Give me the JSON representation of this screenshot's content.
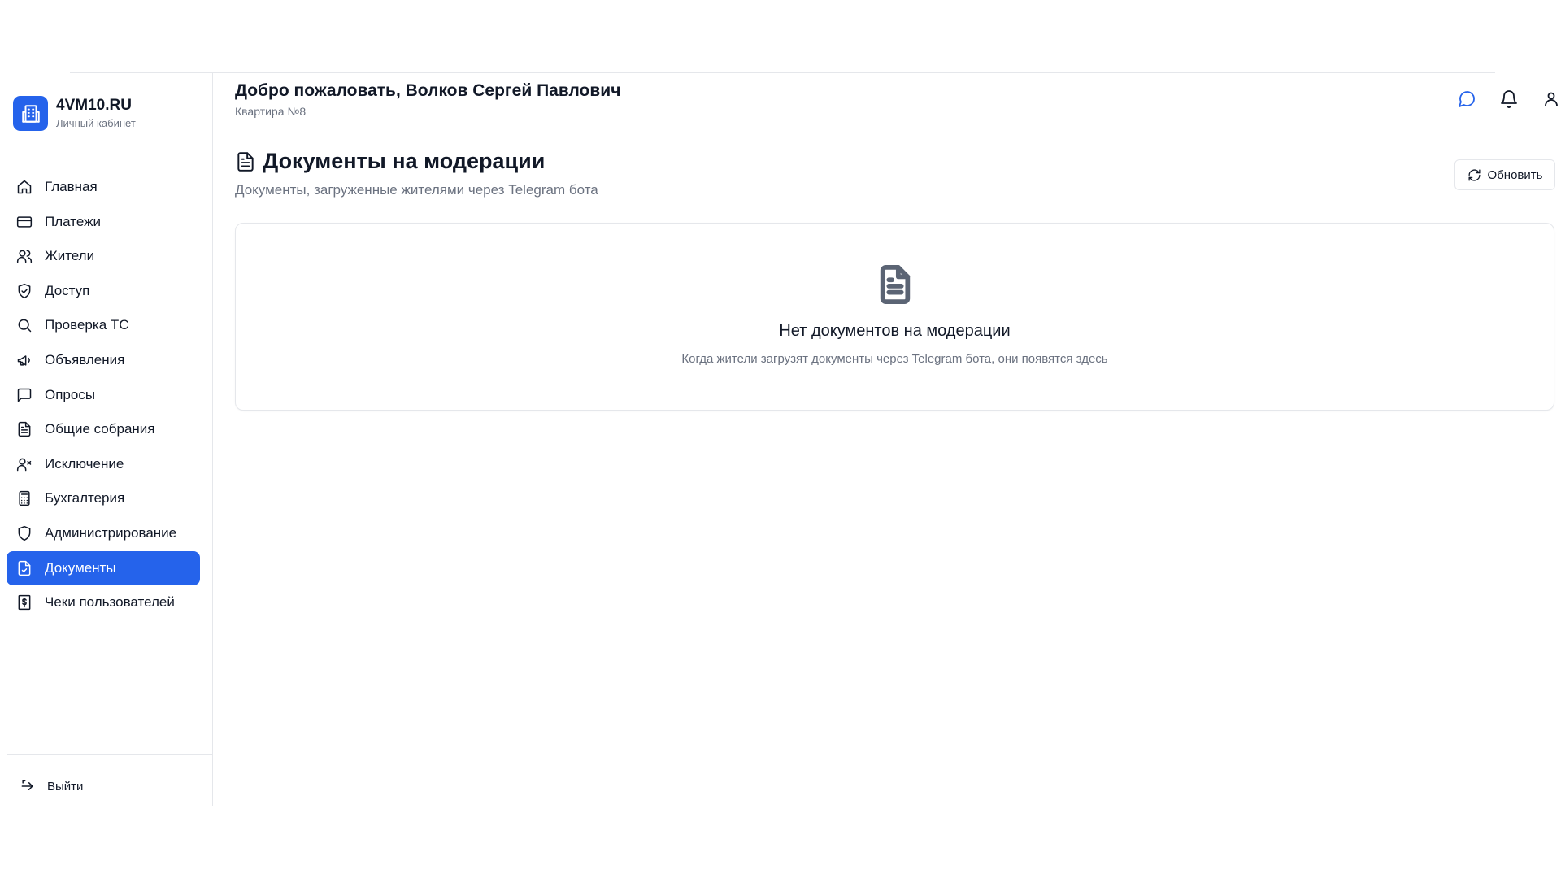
{
  "brand": {
    "title": "4VM10.RU",
    "subtitle": "Личный кабинет"
  },
  "sidebar": {
    "items": [
      {
        "label": "Главная",
        "icon": "home-icon"
      },
      {
        "label": "Платежи",
        "icon": "credit-card-icon"
      },
      {
        "label": "Жители",
        "icon": "users-icon"
      },
      {
        "label": "Доступ",
        "icon": "shield-check-icon"
      },
      {
        "label": "Проверка ТС",
        "icon": "search-icon"
      },
      {
        "label": "Объявления",
        "icon": "megaphone-icon"
      },
      {
        "label": "Опросы",
        "icon": "message-square-icon"
      },
      {
        "label": "Общие собрания",
        "icon": "file-text-icon"
      },
      {
        "label": "Исключение",
        "icon": "user-x-icon"
      },
      {
        "label": "Бухгалтерия",
        "icon": "calculator-icon"
      },
      {
        "label": "Администрирование",
        "icon": "shield-icon"
      },
      {
        "label": "Документы",
        "icon": "file-check-icon",
        "active": true
      },
      {
        "label": "Чеки пользователей",
        "icon": "receipt-dollar-icon"
      }
    ],
    "logout_label": "Выйти"
  },
  "header": {
    "welcome": "Добро пожаловать, Волков Сергей Павлович",
    "apartment": "Квартира №8",
    "icons": [
      "chat-icon",
      "bell-icon",
      "user-icon"
    ]
  },
  "main": {
    "title": "Документы на модерации",
    "subtitle": "Документы, загруженные жителями через Telegram бота",
    "refresh_label": "Обновить",
    "empty": {
      "title": "Нет документов на модерации",
      "subtitle": "Когда жители загрузят документы через Telegram бота, они появятся здесь"
    }
  },
  "colors": {
    "accent": "#2563eb",
    "text": "#111827",
    "muted": "#6b7280",
    "border": "#e5e7eb"
  }
}
